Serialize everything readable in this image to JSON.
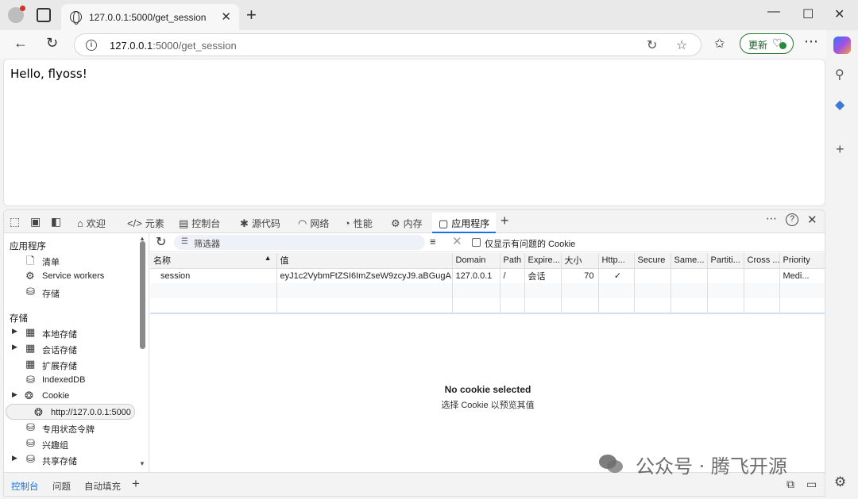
{
  "browser": {
    "tab_title": "127.0.0.1:5000/get_session",
    "url_host": "127.0.0.1",
    "url_path": ":5000/get_session",
    "update_label": "更新"
  },
  "page": {
    "text": "Hello, flyoss!"
  },
  "devtools": {
    "tabs": [
      "欢迎",
      "元素",
      "控制台",
      "源代码",
      "网络",
      "性能",
      "内存",
      "应用程序"
    ],
    "sidebar": {
      "section_app": "应用程序",
      "app_items": [
        "清单",
        "Service workers",
        "存储"
      ],
      "section_storage": "存储",
      "storage_items": [
        "本地存储",
        "会话存储",
        "扩展存储",
        "IndexedDB",
        "Cookie",
        "http://127.0.0.1:5000",
        "专用状态令牌",
        "兴趣组",
        "共享存储"
      ]
    },
    "toolbar": {
      "filter_placeholder": "筛选器",
      "only_issues_label": "仅显示有问题的 Cookie"
    },
    "columns": [
      "名称",
      "值",
      "Domain",
      "Path",
      "Expire...",
      "大小",
      "Http...",
      "Secure",
      "Same...",
      "Partiti...",
      "Cross ...",
      "Priority"
    ],
    "rows": [
      {
        "name": "session",
        "value": "eyJ1c2VybmFtZSI6ImZseW9zcyJ9.aBGugA...",
        "domain": "127.0.0.1",
        "path": "/",
        "expires": "会话",
        "size": "70",
        "httponly": "✓",
        "secure": "",
        "samesite": "",
        "partition": "",
        "cross": "",
        "priority": "Medi..."
      }
    ],
    "empty_title": "No cookie selected",
    "empty_sub": "选择 Cookie 以预览其值",
    "drawer_tabs": [
      "控制台",
      "问题",
      "自动填充"
    ]
  },
  "watermark": "公众号 · 腾飞开源"
}
